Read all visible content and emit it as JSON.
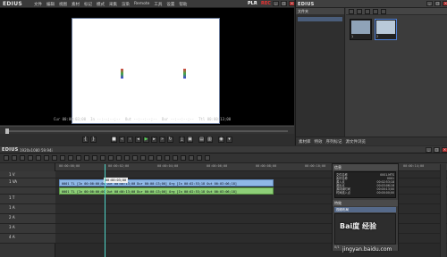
{
  "app": {
    "name": "EDIUS",
    "plr": "PLR",
    "rec": "REC"
  },
  "menu": [
    "文件",
    "编辑",
    "视图",
    "素材",
    "标记",
    "模式",
    "采集",
    "渲染",
    "Remote",
    "工具",
    "设置",
    "帮助"
  ],
  "player": {
    "timecode_in": "Cur 00:00:03;00",
    "timecode_in2": "In --:--:--;--",
    "timecode_out": "Out --:--:--;--",
    "timecode_dur": "Dur --:--:--;--",
    "timecode_ttl": "Ttl 00:00:13;00",
    "transport_icons": [
      "set-in-icon",
      "set-out-icon",
      "stop-icon",
      "rewind-icon",
      "step-back-icon",
      "play-icon",
      "step-forward-icon",
      "fast-forward-icon",
      "loop-icon",
      "insert-icon",
      "overwrite-icon",
      "render-icon"
    ]
  },
  "bin": {
    "title": "EDIUS",
    "tree_header": "文件夹",
    "clips": [
      {
        "caption": "1",
        "color": "#8fa3b8"
      },
      {
        "caption": "2",
        "color": "#b9c9d9"
      }
    ],
    "tabs": [
      "素材库",
      "特效",
      "序列标记",
      "源文件浏览"
    ]
  },
  "timeline": {
    "title": "EDIUS",
    "project_name": "1920x1080 59.94i",
    "ruler_labels": [
      "00:00:00;00",
      "00:00:02;00",
      "00:00:04;00",
      "00:00:06;00",
      "00:00:08;00",
      "00:00:10;00",
      "00:00:12;00",
      "00:00:14;00"
    ],
    "current_tc": "00:00:03;00",
    "tracks": [
      {
        "label": "1 V",
        "type": "video"
      },
      {
        "label": "1 VA",
        "type": "va"
      },
      {
        "label": "",
        "type": "va-sub"
      },
      {
        "label": "1 T",
        "type": "title"
      },
      {
        "label": "1 A",
        "type": "audio"
      },
      {
        "label": "2 A",
        "type": "audio"
      },
      {
        "label": "3 A",
        "type": "audio"
      },
      {
        "label": "4 A",
        "type": "audio"
      }
    ],
    "video_clip": "0001  TL [In 00:00:00;00 Out 00:00:13;00 Dur 00:00:13;00]  Org [In 00:02:53;18 Out 00:03:06;18]",
    "audio_clip": "0001  TL [In 00:00:00;00 Out 00:00:13;00 Dur 00:00:13;00]  Org [In 00:02:53;18 Out 00:03:06;18]"
  },
  "info_palette": {
    "title": "信息",
    "rows": [
      {
        "k": "文件名称",
        "v": "0001.MTS"
      },
      {
        "k": "素材名称",
        "v": "0001"
      },
      {
        "k": "源入点",
        "v": "00:02:53;18"
      },
      {
        "k": "源出点",
        "v": "00:03:06;18"
      },
      {
        "k": "源持续时间",
        "v": "00:00:13;00"
      },
      {
        "k": "时间线入点",
        "v": "00:00:00;00"
      }
    ],
    "fx_title": "特效",
    "fx_item": "视频布局",
    "footer": "0/1"
  },
  "watermark": {
    "brand": "Bai度 经验",
    "url": "jingyan.baidu.com"
  }
}
